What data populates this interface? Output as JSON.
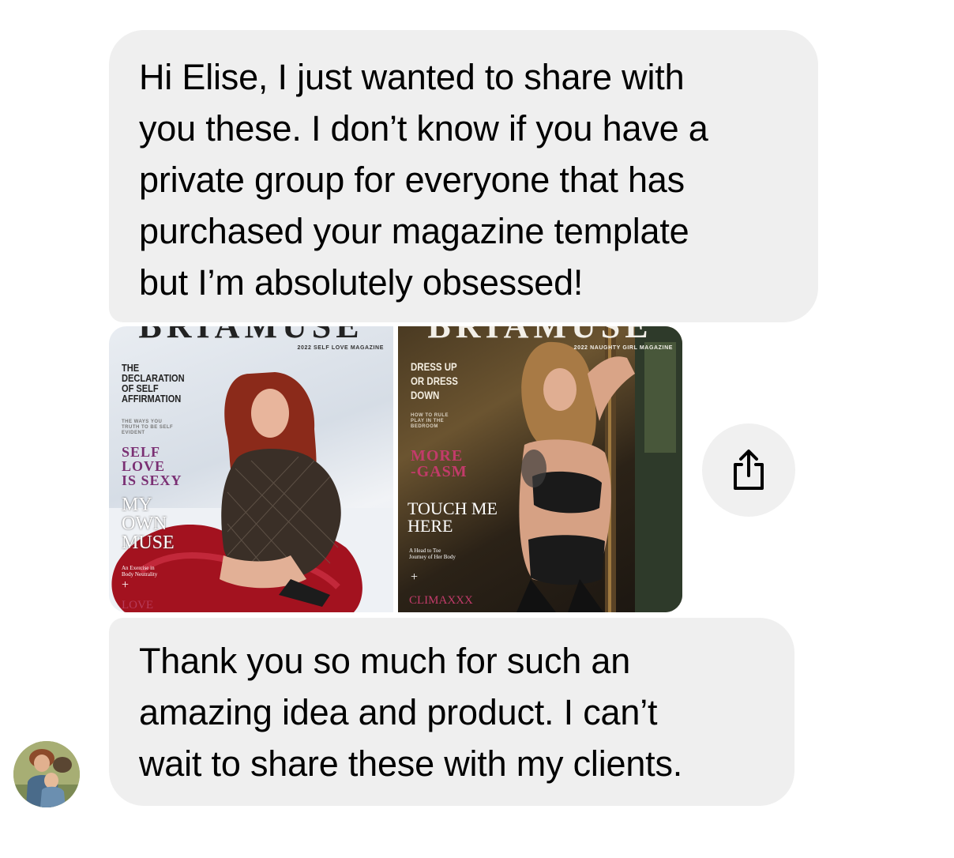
{
  "messages": [
    {
      "text": "Hi Elise, I just wanted to share with\nyou these. I don’t know if you have a\nprivate group for everyone that has\npurchased your magazine template\nbut I’m absolutely obsessed!"
    },
    {
      "text": "Thank you so much for such an\namazing idea and product. I can’t\nwait to share these with my clients."
    }
  ],
  "attachments": [
    {
      "masthead": "BRIAMUSE",
      "issue_label": "2022 SELF LOVE MAGAZINE",
      "headline_1": "THE\nDECLARATION\nOF SELF\nAFFIRMATION",
      "subtext_1": "THE WAYS YOU\nTRUTH TO BE SELF\nEVIDENT",
      "headline_2": "SELF\nLOVE\nIS SEXY",
      "headline_3": "MY\nOWN\nMUSE",
      "subtext_2": "An Exercise in\nBody Neutrality",
      "plus": "+",
      "footer": "LOVE"
    },
    {
      "masthead": "BRIAMUSE",
      "issue_label": "2022 NAUGHTY GIRL MAGAZINE",
      "headline_1": "DRESS UP\nOR DRESS\nDOWN",
      "subtext_1": "HOW TO RULE\nPLAY IN THE\nBEDROOM",
      "headline_2": "MORE\n-GASM",
      "headline_3": "TOUCH ME\nHERE",
      "subtext_2": "A Head to Toe\nJourney of Her Body",
      "plus": "+",
      "footer": "CLIMAXXX"
    }
  ],
  "colors": {
    "bubble_bg": "#efefef",
    "text": "#000000",
    "share_bg": "#f0f0f0",
    "accent_purple": "#7a2f73",
    "accent_pink": "#c23b6a"
  },
  "icons": {
    "share": "share-icon",
    "avatar": "avatar"
  }
}
